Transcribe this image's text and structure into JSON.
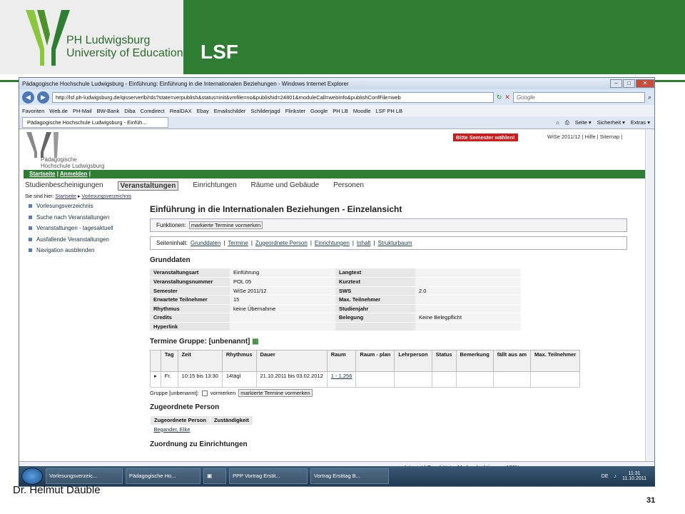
{
  "slide": {
    "brand_line1": "PH Ludwigsburg",
    "brand_line2": "University of Education",
    "title": "LSF",
    "author": "Dr. Helmut Däuble",
    "page_number": "31"
  },
  "browser": {
    "window_title": "Pädagogische Hochschule Ludwigsburg - Einführung: Einführung in die Internationalen Beziehungen - Windows Internet Explorer",
    "url": "http://lsf.ph-ludwigsburg.de/qisserverlb/rds?state=verpublish&status=init&vmfile=no&publishid=24801&moduleCall=webInfo&publishConfFile=web",
    "search_placeholder": "Google",
    "favorites": [
      "Favoriten",
      "Web.de",
      "PH-Mail",
      "BW-Bank",
      "Diba",
      "Comdirect",
      "RealDAX",
      "Ebay",
      "Emailschilder",
      "Schilderjagd",
      "Flinkster",
      "Google",
      "PH LB",
      "Moodle",
      "LSF PH LB"
    ],
    "tab_label": "Pädagogische Hochschule Ludwigsburg - Einfüh...",
    "tools": [
      "Seite ▾",
      "Sicherheit ▾",
      "Extras ▾"
    ],
    "status_text": "Internet | Geschützter Modus: Inaktiv",
    "zoom": "100%"
  },
  "lsf": {
    "logo_line1": "Pädagogische",
    "logo_line2": "Hochschule Ludwigsburg",
    "semester_button": "Bitte Semester wählen!",
    "top_links": "WiSe 2011/12 | Hilfe | Sitemap |",
    "greenbar": [
      "Startseite",
      "Anmelden"
    ],
    "nav": [
      "Studienbescheinigungen",
      "Veranstaltungen",
      "Einrichtungen",
      "Räume und Gebäude",
      "Personen"
    ],
    "breadcrumb_prefix": "Sie sind hier:",
    "breadcrumb": [
      "Startseite",
      "Vorlesungsverzeichnis"
    ],
    "left": [
      "Vorlesungsverzeichnis",
      "Suche nach Veranstaltungen",
      "Veranstaltungen - tagesaktuell",
      "Ausfallende Veranstaltungen",
      "Navigation ausblenden"
    ],
    "heading": "Einführung in die Internationalen Beziehungen - Einzelansicht",
    "functions_label": "Funktionen:",
    "functions_button": "markierte Termine vormerken",
    "contents_label": "Seiteninhalt:",
    "contents": [
      "Grunddaten",
      "Termine",
      "Zugeordnete Person",
      "Einrichtungen",
      "Inhalt",
      "Strukturbaum"
    ],
    "grunddaten_title": "Grunddaten",
    "grunddaten": [
      [
        "Veranstaltungsart",
        "Einführung",
        "Langtext",
        ""
      ],
      [
        "Veranstaltungsnummer",
        "POL 05",
        "Kurztext",
        ""
      ],
      [
        "Semester",
        "WiSe 2011/12",
        "SWS",
        "2.0"
      ],
      [
        "Erwartete Teilnehmer",
        "15",
        "Max. Teilnehmer",
        ""
      ],
      [
        "Rhythmus",
        "keine Übernahme",
        "Studienjahr",
        ""
      ],
      [
        "Credits",
        "",
        "Belegung",
        "Keine Belegpflicht"
      ],
      [
        "Hyperlink",
        "",
        "",
        ""
      ]
    ],
    "termine_title": "Termine Gruppe: [unbenannt]",
    "termine_headers": [
      "",
      "Tag",
      "Zeit",
      "Rhythmus",
      "Dauer",
      "Raum",
      "Raum - plan",
      "Lehrperson",
      "Status",
      "Bemerkung",
      "fällt aus am",
      "Max. Teilnehmer"
    ],
    "termine_row": [
      "",
      "Fr.",
      "10:15 bis 13:30",
      "14tägl",
      "21.10.2011 bis 03.02.2012",
      "1 - 1.256",
      "",
      "",
      "",
      "",
      "",
      ""
    ],
    "gruppe_label": "Gruppe [unbenannt]:",
    "gruppe_check": "vormerken",
    "gruppe_button": "markierte Termine vormerken",
    "person_title": "Zugeordnete Person",
    "person_headers": [
      "Zugeordnete Person",
      "Zuständigkeit"
    ],
    "person_row": [
      "Begander, Elke",
      ""
    ],
    "next_title": "Zuordnung zu Einrichtungen"
  },
  "taskbar": {
    "items": [
      "Vorlesungsverzeic...",
      "Pädagogische Ho...",
      "",
      "PPP Vortrag Erstit...",
      "Vortrag Erstitag B..."
    ],
    "lang": "DE",
    "time": "11:31",
    "date": "11.10.2011"
  }
}
